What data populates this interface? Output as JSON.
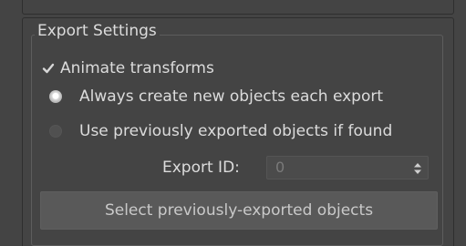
{
  "colors": {
    "panel_bg": "#444444",
    "text": "#dcdcdc",
    "disabled_text": "#7a7a7a",
    "button_bg": "#595959"
  },
  "export_settings": {
    "group_title": "Export Settings",
    "animate_transforms": {
      "label": "Animate transforms",
      "checked": true
    },
    "radio_always_new": {
      "label": "Always create new objects each export",
      "selected": true
    },
    "radio_use_previous": {
      "label": "Use previously exported objects if found",
      "selected": false
    },
    "export_id": {
      "label": "Export ID:",
      "value": "0"
    },
    "select_button_label": "Select previously-exported objects"
  }
}
